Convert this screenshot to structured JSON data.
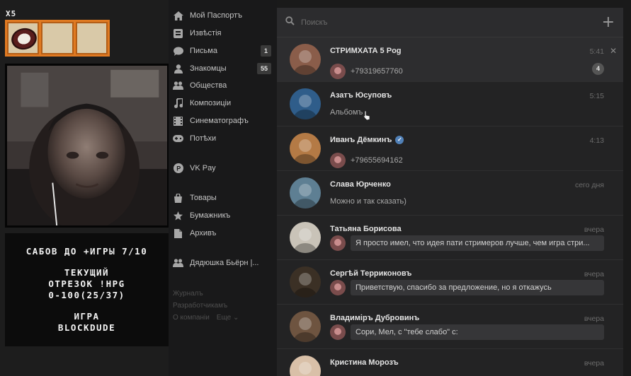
{
  "overlay": {
    "multiplier": "X5",
    "goals": {
      "line1": "САБОВ ДО +ИГРЫ 7/10",
      "line2": "ТЕКУЩИЙ",
      "line3": "ОТРЕЗОК !HPG",
      "line4": "0-100(25/37)",
      "line5": "ИГРА",
      "line6": "BLOCKDUDE"
    }
  },
  "nav": {
    "items": [
      {
        "label": "Мой Паспортъ",
        "icon": "home-icon"
      },
      {
        "label": "Извѣстія",
        "icon": "news-icon"
      },
      {
        "label": "Письма",
        "icon": "messages-icon",
        "count": "1"
      },
      {
        "label": "Знакомцы",
        "icon": "friends-icon",
        "count": "55"
      },
      {
        "label": "Общества",
        "icon": "groups-icon"
      },
      {
        "label": "Композиціи",
        "icon": "music-icon"
      },
      {
        "label": "Синематографъ",
        "icon": "video-icon"
      },
      {
        "label": "Потѣхи",
        "icon": "games-icon"
      },
      {
        "label": "VK Pay",
        "icon": "vkpay-icon"
      },
      {
        "label": "Товары",
        "icon": "market-icon"
      },
      {
        "label": "Бумажникъ",
        "icon": "bookmarks-icon"
      },
      {
        "label": "Архивъ",
        "icon": "archive-icon"
      },
      {
        "label": "Дядюшка Бьёрн |...",
        "icon": "community-icon"
      }
    ],
    "footer": {
      "blog": "Журналъ",
      "developers": "Разработчикамъ",
      "about": "О компаніи",
      "more": "Еще"
    }
  },
  "dialogs": {
    "search_placeholder": "Поискъ",
    "chats": [
      {
        "name": "СТРИМХАТА 5 Pog",
        "time": "5:41",
        "message": "+79319657760",
        "unread": "4",
        "avatar_color": "#8a5d4a"
      },
      {
        "name": "Азатъ Юсуповъ",
        "time": "5:15",
        "message": "Альбомъ",
        "avatar_color": "#2f5d8a"
      },
      {
        "name": "Иванъ Дёмкинъ",
        "time": "4:13",
        "message": "+79655694162",
        "verified": true,
        "avatar_color": "#b47a45"
      },
      {
        "name": "Слава Юрченко",
        "time": "сего дня",
        "message": "Можно и так сказать)",
        "avatar_color": "#5e7f93"
      },
      {
        "name": "Татьяна Борисова",
        "time": "вчера",
        "message": "Я просто имел, что идея пати стримеров лучше, чем игра стри...",
        "avatar_color": "#c9c3b8"
      },
      {
        "name": "Сергѣй Терриконовъ",
        "time": "вчера",
        "message": "Приветствую, спасибо за предложение, но я откажусь",
        "avatar_color": "#3b3025"
      },
      {
        "name": "Владиміръ Дубровинъ",
        "time": "вчера",
        "message": "Сори, Мел, с \"тебе слабо\" с:",
        "avatar_color": "#6e5440"
      },
      {
        "name": "Кристина Морозъ",
        "time": "вчера",
        "message": "",
        "avatar_color": "#d9c0a8"
      }
    ]
  },
  "colors": {
    "panel": "#232324",
    "accent_verified": "#5181b8",
    "overlay_border": "#e07a22"
  }
}
